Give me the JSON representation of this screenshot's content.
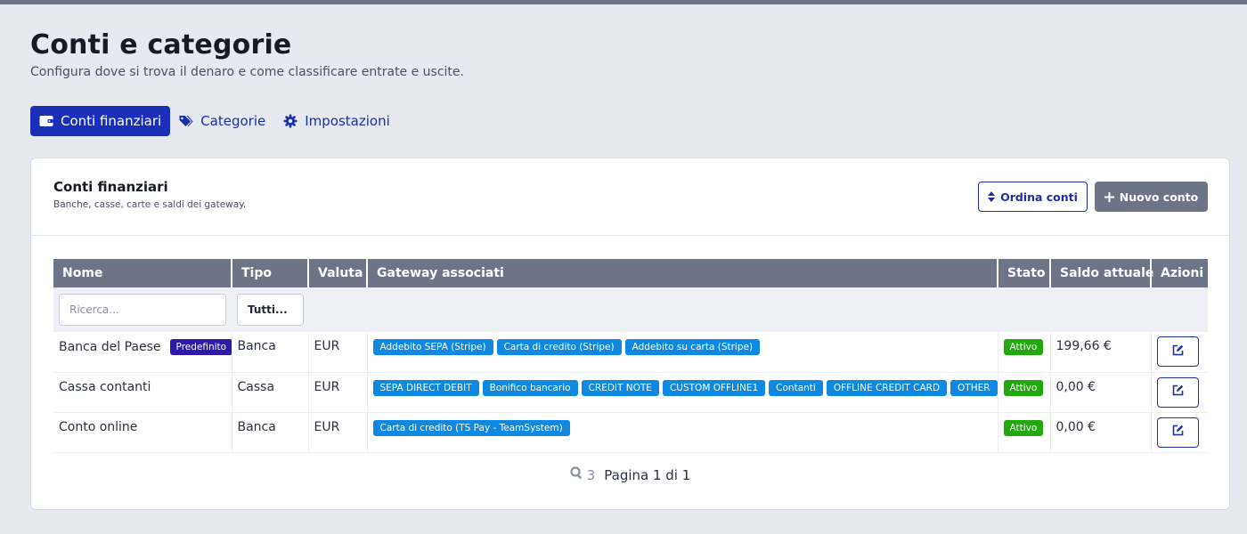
{
  "page": {
    "title": "Conti e categorie",
    "subtitle": "Configura dove si trova il denaro e come classificare entrate e uscite."
  },
  "tabs": [
    {
      "label": "Conti finanziari",
      "icon": "wallet-icon",
      "active": true
    },
    {
      "label": "Categorie",
      "icon": "tags-icon",
      "active": false
    },
    {
      "label": "Impostazioni",
      "icon": "gear-icon",
      "active": false
    }
  ],
  "card": {
    "title": "Conti finanziari",
    "subtitle": "Banche, casse, carte e saldi dei gateway.",
    "sort_button": "Ordina conti",
    "new_button": "Nuovo conto"
  },
  "table": {
    "columns": [
      "Nome",
      "Tipo",
      "Valuta",
      "Gateway associati",
      "Stato",
      "Saldo attuale",
      "Azioni"
    ],
    "filters": {
      "search_placeholder": "Ricerca...",
      "type_selected": "Tutti..."
    },
    "rows": [
      {
        "name": "Banca del Paese",
        "badge": "Predefinito",
        "type": "Banca",
        "currency": "EUR",
        "gateways": [
          "Addebito SEPA (Stripe)",
          "Carta di credito (Stripe)",
          "Addebito su carta (Stripe)"
        ],
        "status": "Attivo",
        "balance": "199,66 €"
      },
      {
        "name": "Cassa contanti",
        "badge": "",
        "type": "Cassa",
        "currency": "EUR",
        "gateways": [
          "SEPA DIRECT DEBIT",
          "Bonifico bancario",
          "CREDIT NOTE",
          "CUSTOM OFFLINE1",
          "Contanti",
          "OFFLINE CREDIT CARD",
          "OTHER"
        ],
        "status": "Attivo",
        "balance": "0,00 €"
      },
      {
        "name": "Conto online",
        "badge": "",
        "type": "Banca",
        "currency": "EUR",
        "gateways": [
          "Carta di credito (TS Pay - TeamSystem)"
        ],
        "status": "Attivo",
        "balance": "0,00 €"
      }
    ]
  },
  "pager": {
    "count": "3",
    "label": "Pagina 1 di 1"
  },
  "colors": {
    "primary": "#1a2eb8",
    "header_gray": "#6e7488",
    "gateway_blue": "#0e88e0",
    "active_green": "#22a80e",
    "default_badge": "#2d1aa8"
  }
}
